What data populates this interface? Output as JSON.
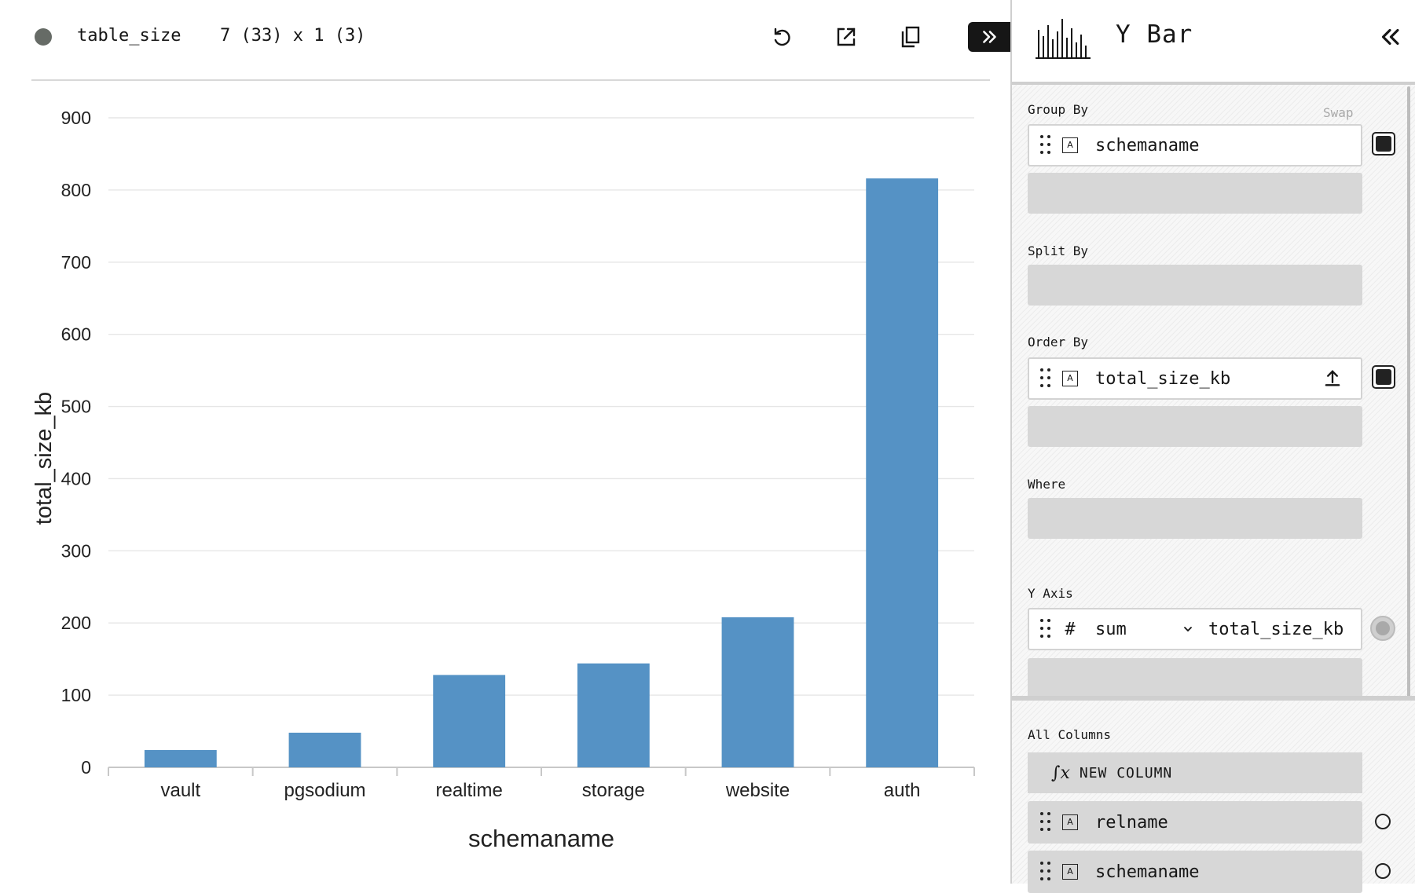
{
  "header": {
    "table_name": "table_size",
    "dimensions": "7 (33) x 1 (3)",
    "status_color": "#666b66"
  },
  "toolbar": {
    "icons": [
      "reset-icon",
      "export-icon",
      "copy-icon",
      "settings-toggle-icon"
    ]
  },
  "side_panel": {
    "plugin_name": "Y Bar",
    "group_by": {
      "label": "Group By",
      "swap_label": "Swap",
      "column": "schemaname"
    },
    "split_by": {
      "label": "Split By"
    },
    "order_by": {
      "label": "Order By",
      "column": "total_size_kb"
    },
    "where": {
      "label": "Where"
    },
    "y_axis": {
      "label": "Y Axis",
      "aggregate": "sum",
      "column": "total_size_kb",
      "type_symbol": "#"
    },
    "all_columns": {
      "label": "All Columns",
      "new_column_label": "NEW COLUMN",
      "items": [
        "relname",
        "schemaname"
      ]
    }
  },
  "chart_data": {
    "type": "bar",
    "categories": [
      "vault",
      "pgsodium",
      "realtime",
      "storage",
      "website",
      "auth"
    ],
    "values": [
      24,
      48,
      128,
      144,
      208,
      816
    ],
    "xlabel": "schemaname",
    "ylabel": "total_size_kb",
    "ylim": [
      0,
      900
    ],
    "yticks": [
      0,
      100,
      200,
      300,
      400,
      500,
      600,
      700,
      800,
      900
    ],
    "grid": true,
    "bar_color": "#5592c5"
  }
}
